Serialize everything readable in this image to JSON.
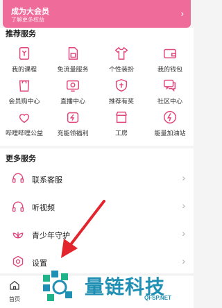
{
  "vip": {
    "title": "成为大会员",
    "subtitle": "了解更多权益",
    "chevron": "›"
  },
  "recommended": {
    "title": "推荐服务",
    "items": [
      {
        "label": "我的课程",
        "icon": "course-icon"
      },
      {
        "label": "免流量服务",
        "icon": "sim-card-icon"
      },
      {
        "label": "个性装扮",
        "icon": "tshirt-icon"
      },
      {
        "label": "我的钱包",
        "icon": "wallet-icon"
      },
      {
        "label": "会员购中心",
        "icon": "shopping-icon"
      },
      {
        "label": "直播中心",
        "icon": "live-tv-icon"
      },
      {
        "label": "推荐有奖",
        "icon": "reward-shield-icon"
      },
      {
        "label": "社区中心",
        "icon": "chat-bubbles-icon"
      },
      {
        "label": "哔哩哔哩公益",
        "icon": "charity-icon"
      },
      {
        "label": "充能领福利",
        "icon": "charge-icon"
      },
      {
        "label": "工房",
        "icon": "store-icon"
      },
      {
        "label": "能量加油站",
        "icon": "lightning-icon"
      }
    ]
  },
  "more": {
    "title": "更多服务",
    "items": [
      {
        "label": "联系客服",
        "icon": "headset-icon"
      },
      {
        "label": "听视频",
        "icon": "headphones-icon"
      },
      {
        "label": "青少年守护",
        "icon": "leaf-icon"
      },
      {
        "label": "设置",
        "icon": "settings-icon"
      }
    ],
    "chevron": "›"
  },
  "tabbar": {
    "home_label": "首页"
  },
  "watermark": {
    "text": "量链科技",
    "url": "QFSP.NET"
  },
  "colors": {
    "accent": "#ef6b9a",
    "icon": "#e0457b",
    "watermark": "#1f8fb3",
    "arrow": "#e3262e"
  }
}
